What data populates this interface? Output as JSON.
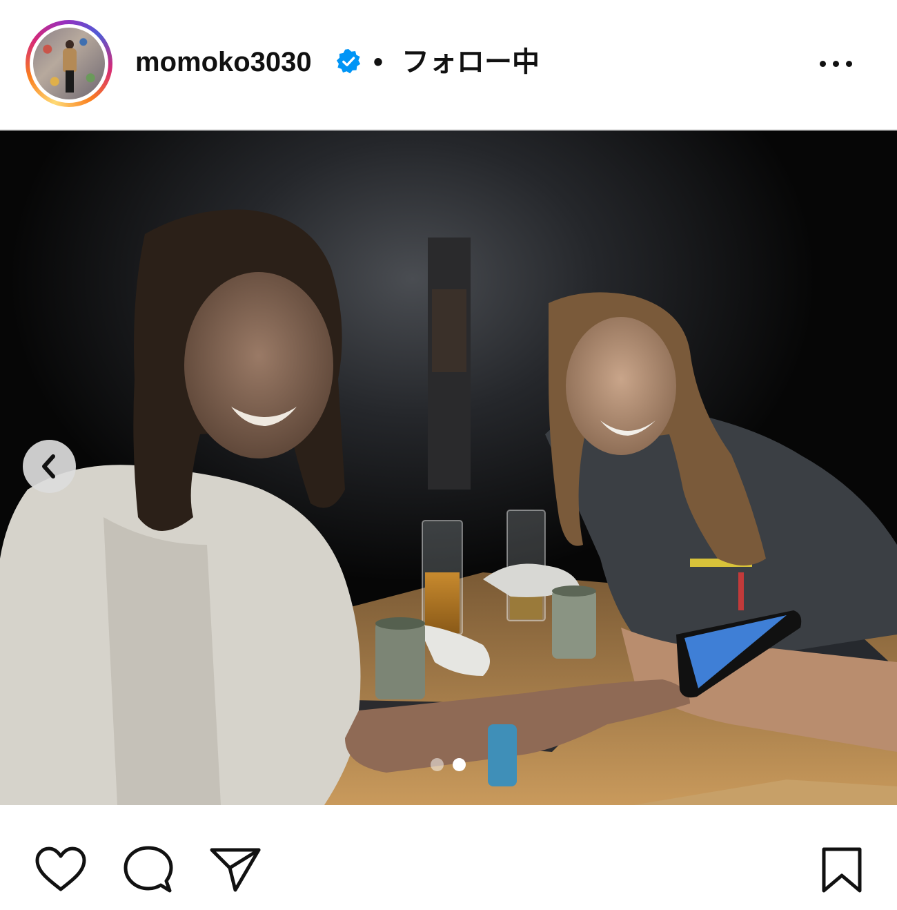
{
  "post_header": {
    "username": "momoko3030",
    "separator": "•",
    "follow_status": "フォロー中",
    "verified": true
  },
  "carousel": {
    "slide_count": 2,
    "active_slide": 2
  },
  "icons": {
    "more": "more-options-icon",
    "prev": "chevron-left-icon",
    "like": "heart-icon",
    "comment": "comment-icon",
    "share": "send-icon",
    "save": "bookmark-icon",
    "verified": "verified-badge-icon"
  },
  "colors": {
    "verified_blue": "#0095f6",
    "text": "#111111",
    "background": "#ffffff"
  }
}
